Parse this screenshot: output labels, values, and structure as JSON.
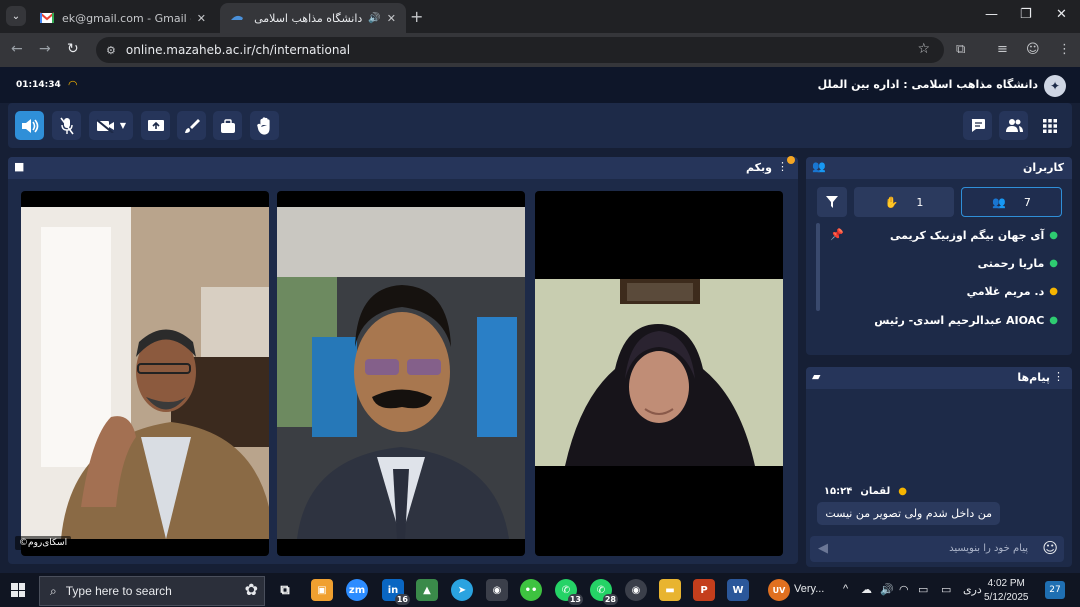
{
  "browser": {
    "tabs": [
      {
        "title": "جلسه - Gmail - bek@gmail.com",
        "display": "ek@gmail.com - Gmail - جلسه",
        "favicon": "gmail-icon"
      },
      {
        "title": "دانشگاه مذاهب اسلامی - ادار",
        "favicon": "mazaheb-icon",
        "audio": "speaker-icon"
      }
    ],
    "url": "online.mazaheb.ac.ir/ch/international"
  },
  "app": {
    "timer": "01:14:34",
    "title": "دانشگاه مذاهب اسلامی : اداره بین الملل",
    "colors": {
      "accent": "#2f8fd8",
      "panel": "#1d2a48",
      "background": "#161f35",
      "online": "#2ecc71",
      "host": "#f5b400"
    },
    "webcam": {
      "title": "وبکم",
      "watermark": "©اسکای‌روم"
    },
    "users": {
      "title": "کاربران",
      "tab_all_count": "7",
      "tab_hand_count": "1",
      "list": [
        {
          "name": "آی جهان بیگم اوزبیک کریمی",
          "role": "online",
          "pinned": true
        },
        {
          "name": "ماریا رحمتی",
          "role": "online"
        },
        {
          "name": "د. مریم غلامي",
          "role": "host"
        },
        {
          "name": "عبدالرحیم اسدی- رئیس AIOAC",
          "role": "online"
        }
      ]
    },
    "messages": {
      "title": "پیام‌ها",
      "items": [
        {
          "sender": "لقمان",
          "time": "۱۵:۲۴",
          "text": "من داخل شدم ولی تصویر من نیست"
        }
      ],
      "input_placeholder": "پیام خود را بنویسید"
    }
  },
  "taskbar": {
    "search_placeholder": "Type here to search",
    "apps": [
      {
        "name": "linkedin",
        "label": "in",
        "badge": "16"
      },
      {
        "name": "whatsapp",
        "label": "",
        "badge": "13"
      },
      {
        "name": "whatsapp-2",
        "label": "",
        "badge": "28"
      }
    ],
    "weather_label": "Very...",
    "weather_badge": "UV",
    "lang": "دری",
    "time": "4:02 PM",
    "date": "5/12/2025",
    "notifications": "27"
  }
}
